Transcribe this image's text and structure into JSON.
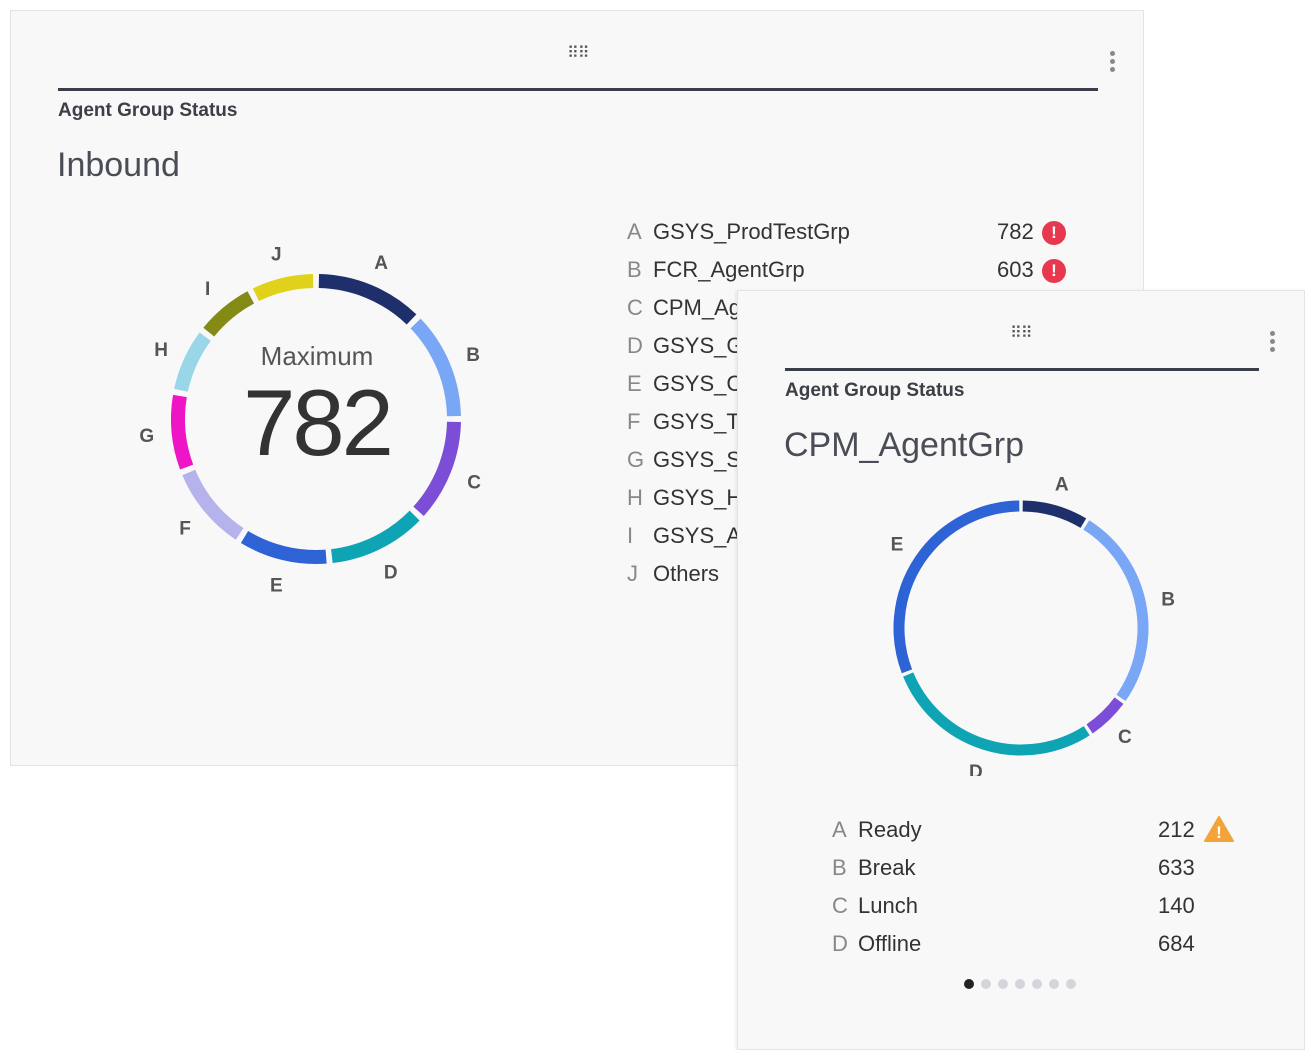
{
  "card_inbound": {
    "handle_icon": "drag-handle-icon",
    "menu_icon": "more-vertical-icon",
    "label": "Agent Group Status",
    "title": "Inbound",
    "center_caption": "Maximum",
    "center_value": "782",
    "legend": [
      {
        "letter": "A",
        "name": "GSYS_ProdTestGrp",
        "value": "782",
        "alert": true
      },
      {
        "letter": "B",
        "name": "FCR_AgentGrp",
        "value": "603",
        "alert": true
      },
      {
        "letter": "C",
        "name": "CPM_Ag",
        "value": "",
        "alert": false
      },
      {
        "letter": "D",
        "name": "GSYS_G",
        "value": "",
        "alert": false
      },
      {
        "letter": "E",
        "name": "GSYS_C",
        "value": "",
        "alert": false
      },
      {
        "letter": "F",
        "name": "GSYS_T",
        "value": "",
        "alert": false
      },
      {
        "letter": "G",
        "name": "GSYS_S",
        "value": "",
        "alert": false
      },
      {
        "letter": "H",
        "name": "GSYS_H",
        "value": "",
        "alert": false
      },
      {
        "letter": "I",
        "name": "GSYS_A",
        "value": "",
        "alert": false
      },
      {
        "letter": "J",
        "name": "Others",
        "value": "",
        "alert": false
      }
    ],
    "alert_glyph": "!",
    "ring_segments": [
      {
        "label": "A",
        "color": "#1e2f6b",
        "share": 0.125
      },
      {
        "label": "B",
        "color": "#79a6f5",
        "share": 0.125
      },
      {
        "label": "C",
        "color": "#7c4ed8",
        "share": 0.12
      },
      {
        "label": "D",
        "color": "#0fa4b4",
        "share": 0.115
      },
      {
        "label": "E",
        "color": "#2d63d5",
        "share": 0.105
      },
      {
        "label": "F",
        "color": "#b6b3ec",
        "share": 0.1
      },
      {
        "label": "G",
        "color": "#ee15c6",
        "share": 0.09
      },
      {
        "label": "H",
        "color": "#98d6e8",
        "share": 0.075
      },
      {
        "label": "I",
        "color": "#838b14",
        "share": 0.07
      },
      {
        "label": "J",
        "color": "#e0d21a",
        "share": 0.075
      }
    ]
  },
  "card_cpm": {
    "handle_icon": "drag-handle-icon",
    "menu_icon": "more-vertical-icon",
    "label": "Agent Group Status",
    "title": "CPM_AgentGrp",
    "legend": [
      {
        "letter": "A",
        "name": "Ready",
        "value": "212",
        "warn": true
      },
      {
        "letter": "B",
        "name": "Break",
        "value": "633",
        "warn": false
      },
      {
        "letter": "C",
        "name": "Lunch",
        "value": "140",
        "warn": false
      },
      {
        "letter": "D",
        "name": "Offline",
        "value": "684",
        "warn": false
      }
    ],
    "warn_glyph": "!",
    "ring_segments": [
      {
        "label": "A",
        "color": "#1e2f6b",
        "value": 212
      },
      {
        "label": "B",
        "color": "#79a6f5",
        "value": 633
      },
      {
        "label": "C",
        "color": "#7c4ed8",
        "value": 140
      },
      {
        "label": "D",
        "color": "#0fa4b4",
        "value": 684
      },
      {
        "label": "E",
        "color": "#2d63d5",
        "value": 750
      }
    ],
    "pager": {
      "count": 7,
      "active": 0
    }
  }
}
